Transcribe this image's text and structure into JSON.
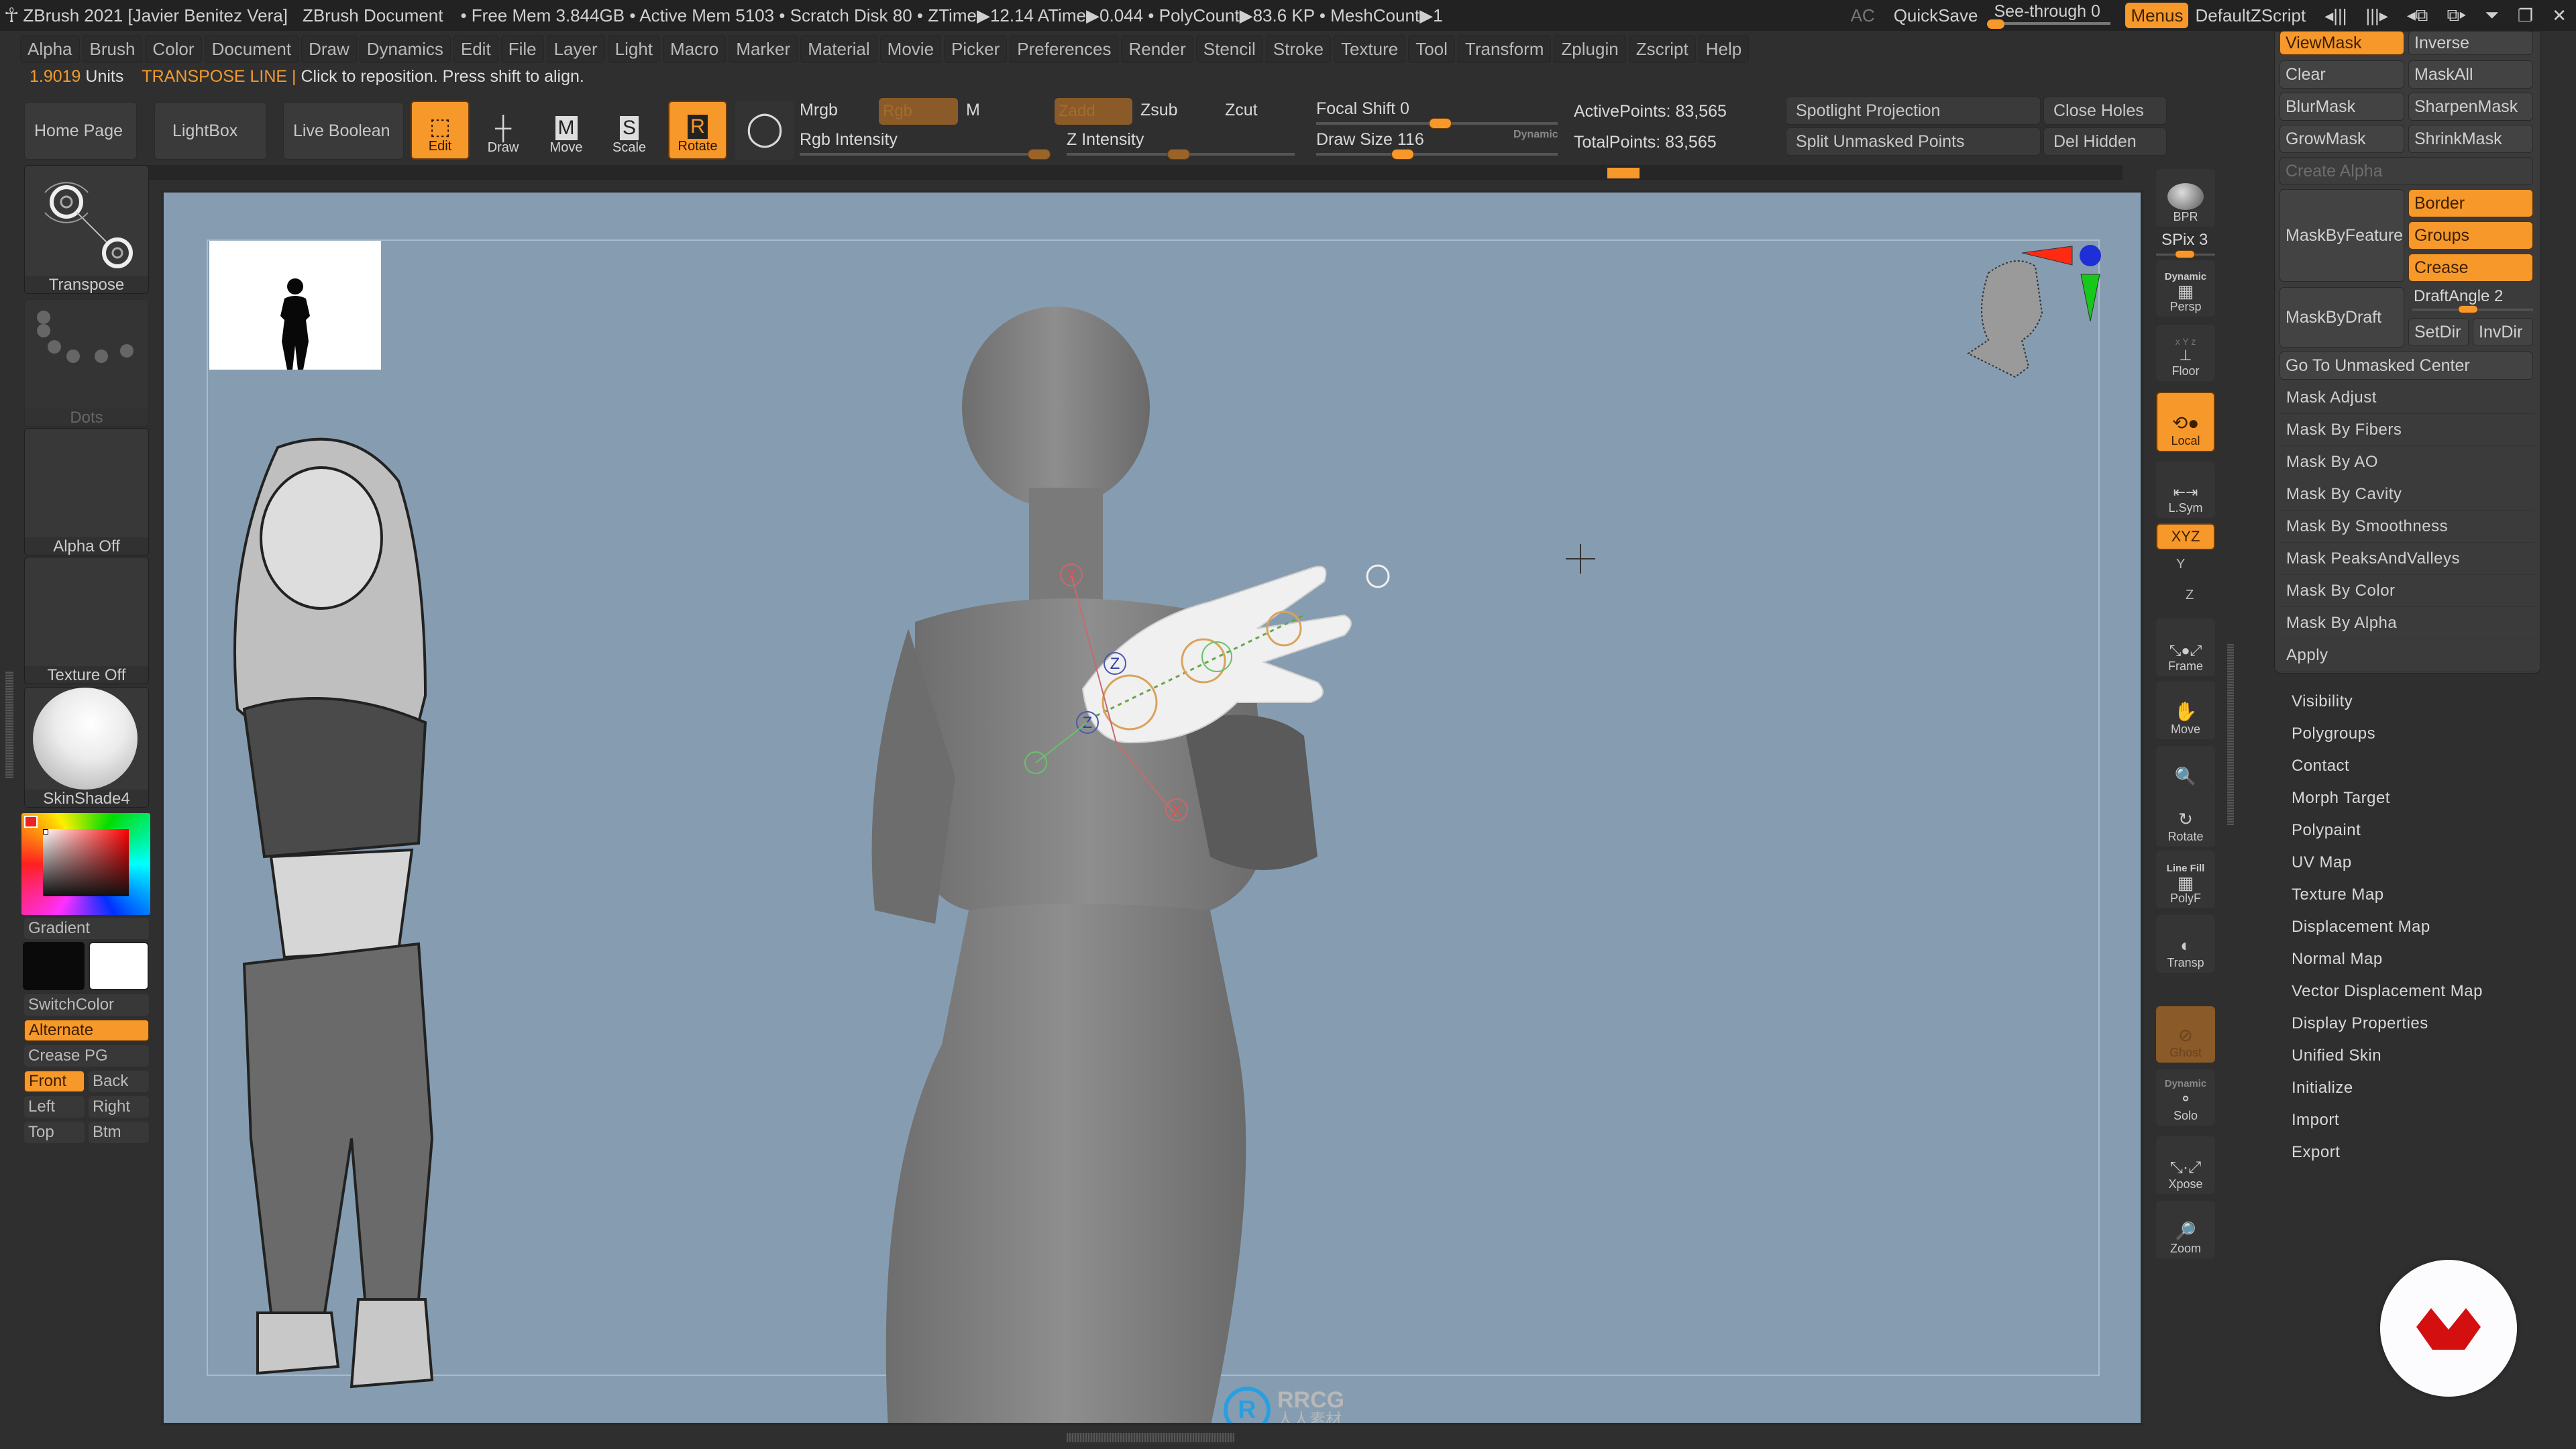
{
  "titlebar": {
    "app_title": "ZBrush 2021 [Javier Benitez Vera]",
    "document": "ZBrush Document",
    "stats": "• Free Mem 3.844GB • Active Mem 5103 • Scratch Disk 80 •  ZTime▶12.14 ATime▶0.044 • PolyCount▶83.6 KP  • MeshCount▶1",
    "ac": "AC",
    "quicksave": "QuickSave",
    "see_through": "See-through  0",
    "see_through_value": 0,
    "menus": "Menus",
    "default_zscript": "DefaultZScript"
  },
  "menubar": [
    "Alpha",
    "Brush",
    "Color",
    "Document",
    "Draw",
    "Dynamics",
    "Edit",
    "File",
    "Layer",
    "Light",
    "Macro",
    "Marker",
    "Material",
    "Movie",
    "Picker",
    "Preferences",
    "Render",
    "Stencil",
    "Stroke",
    "Texture",
    "Tool",
    "Transform",
    "Zplugin",
    "Zscript",
    "Help"
  ],
  "infoline": {
    "units_value": "1.9019",
    "units_label": "Units",
    "mode": "TRANSPOSE LINE |",
    "hint": "Click to reposition. Press shift to align."
  },
  "toolbar": {
    "home_page": "Home Page",
    "lightbox": "LightBox",
    "live_boolean": "Live Boolean",
    "edit": "Edit",
    "draw": "Draw",
    "move": "Move",
    "scale": "Scale",
    "rotate": "Rotate",
    "mrgb": "Mrgb",
    "rgb": "Rgb",
    "m": "M",
    "zadd": "Zadd",
    "zsub": "Zsub",
    "zcut": "Zcut",
    "rgb_intensity": "Rgb Intensity",
    "z_intensity": "Z Intensity",
    "focal_shift": "Focal Shift 0",
    "focal_shift_value": 0,
    "draw_size": "Draw Size 116",
    "draw_size_value": 116,
    "dynamic": "Dynamic",
    "active_points": "ActivePoints: 83,565",
    "total_points": "TotalPoints: 83,565",
    "spotlight_projection": "Spotlight Projection",
    "split_unmasked_points": "Split Unmasked Points",
    "close_holes": "Close Holes",
    "del_hidden": "Del Hidden"
  },
  "left_shelf": {
    "brush": "Transpose",
    "stroke": "Dots",
    "alpha": "Alpha Off",
    "texture": "Texture Off",
    "material": "SkinShade4",
    "gradient": "Gradient",
    "switch_color": "SwitchColor",
    "alternate": "Alternate",
    "crease_pg": "Crease PG",
    "front": "Front",
    "back": "Back",
    "left": "Left",
    "right": "Right",
    "top": "Top",
    "btm": "Btm",
    "primary_color": "#0a0a0a",
    "secondary_color": "#ffffff"
  },
  "right_shelf": {
    "bpr": "BPR",
    "spix": "SPix 3",
    "spix_value": 3,
    "persp_top": "Dynamic",
    "persp": "Persp",
    "floor_axes": "x Y z",
    "floor": "Floor",
    "local": "Local",
    "lsym": "L.Sym",
    "xyz": "XYZ",
    "y": "Y",
    "z": "Z",
    "frame": "Frame",
    "move": "Move",
    "zoom3d": "Zoom3D",
    "rotate": "Rotate",
    "polyf_top": "Line Fill",
    "polyf": "PolyF",
    "transp": "Transp",
    "ghost": "Ghost",
    "solo_top": "Dynamic",
    "solo": "Solo",
    "xpose": "Xpose",
    "zoom": "Zoom"
  },
  "masking": {
    "viewmask": "ViewMask",
    "inverse": "Inverse",
    "clear": "Clear",
    "maskall": "MaskAll",
    "blurmask": "BlurMask",
    "sharpenmask": "SharpenMask",
    "growmask": "GrowMask",
    "shrinkmask": "ShrinkMask",
    "create_alpha": "Create Alpha",
    "mask_by_feature": "MaskByFeature",
    "border": "Border",
    "groups": "Groups",
    "crease": "Crease",
    "mask_by_draft": "MaskByDraft",
    "draft_angle": "DraftAngle  2",
    "draft_angle_value": 2,
    "setdir": "SetDir",
    "invdir": "InvDir",
    "go_to_unmasked_center": "Go To Unmasked Center",
    "subpalettes": [
      "Mask Adjust",
      "Mask By Fibers",
      "Mask By AO",
      "Mask By Cavity",
      "Mask By Smoothness",
      "Mask PeaksAndValleys",
      "Mask By Color",
      "Mask By Alpha",
      "Apply"
    ]
  },
  "tool_subpalettes": [
    "Visibility",
    "Polygroups",
    "Contact",
    "Morph Target",
    "Polypaint",
    "UV Map",
    "Texture Map",
    "Displacement Map",
    "Normal Map",
    "Vector Displacement Map",
    "Display Properties",
    "Unified Skin",
    "Initialize",
    "Import",
    "Export"
  ],
  "viewport": {
    "gizmo_labels": {
      "x": "X",
      "z": "Z"
    },
    "watermark_title": "RRCG",
    "watermark_sub": "人人素材"
  },
  "colors": {
    "accent": "#f7982a",
    "viewport_bg": "#869db1",
    "panel_bg": "#2f2f2f"
  }
}
